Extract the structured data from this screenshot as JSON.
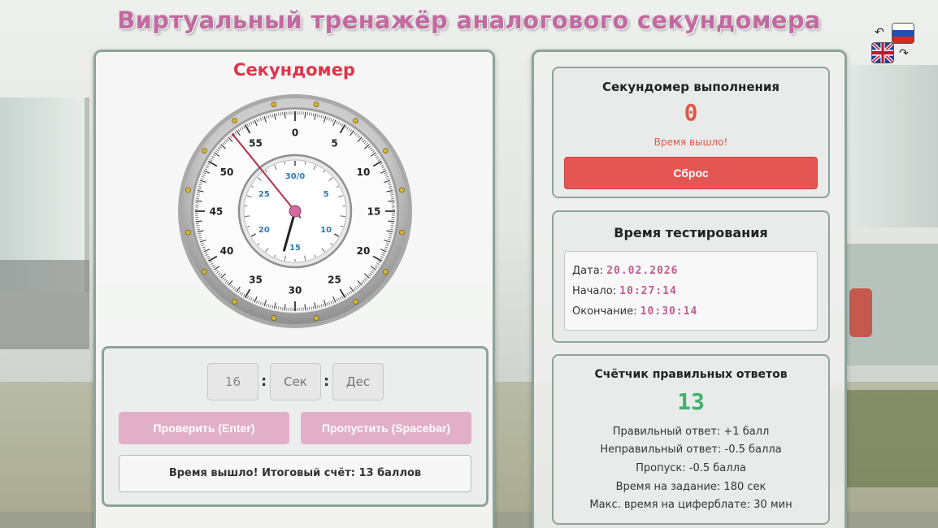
{
  "title": "Виртуальный тренажёр аналогового секундомера",
  "language_switch": {
    "ru_flag": "russia-flag-icon",
    "uk_flag": "uk-flag-icon"
  },
  "stopwatch": {
    "heading": "Секундомер",
    "outer_labels": [
      "0",
      "5",
      "10",
      "15",
      "20",
      "25",
      "30",
      "35",
      "40",
      "45",
      "50",
      "55"
    ],
    "inner_labels": [
      "30/0",
      "5",
      "10",
      "15",
      "20",
      "25"
    ],
    "second_hand_value": 53.5,
    "minute_hand_value": 16.3,
    "colors": {
      "second_hand": "#b3314a",
      "minute_hand": "#222222",
      "pivot": "#d46a9f",
      "inner_numbers": "#2a7ab8"
    }
  },
  "answer": {
    "minutes_value": "16",
    "seconds_placeholder": "Сек",
    "tenths_placeholder": "Дес",
    "separator": ":",
    "check_label": "Проверить (Enter)",
    "skip_label": "Пропустить (Spacebar)",
    "result_text": "Время вышло! Итоговый счёт: 13 баллов"
  },
  "execution": {
    "heading": "Секундомер выполнения",
    "value": "0",
    "status": "Время вышло!",
    "reset_label": "Сброс"
  },
  "testing_time": {
    "heading": "Время тестирования",
    "date_label": "Дата:",
    "date_value": "20.02.2026",
    "start_label": "Начало:",
    "start_value": "10:27:14",
    "end_label": "Окончание:",
    "end_value": "10:30:14"
  },
  "counter": {
    "heading": "Счётчик правильных ответов",
    "value": "13",
    "rules": [
      "Правильный ответ: +1 балл",
      "Неправильный ответ: -0.5 балла",
      "Пропуск: -0.5 балла",
      "Время на задание: 180 сек",
      "Макс. время на циферблате: 30 мин"
    ]
  },
  "colors": {
    "title": "#c26aa0",
    "accent_red": "#e35653",
    "counter_green": "#3db36a",
    "exec_red": "#e0574a"
  }
}
